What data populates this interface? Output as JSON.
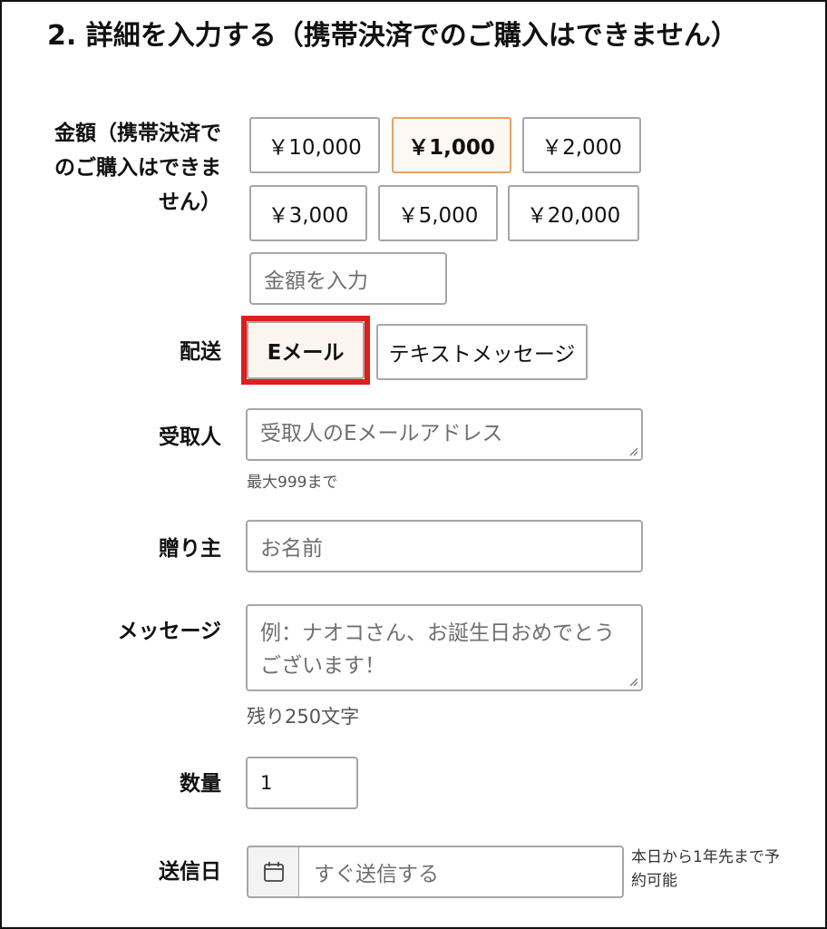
{
  "section": {
    "title": "2. 詳細を入力する（携帯決済でのご購入はできません）"
  },
  "amount": {
    "label": "金額（携帯決済でのご購入はできません）",
    "options": [
      "￥10,000",
      "￥1,000",
      "￥2,000",
      "￥3,000",
      "￥5,000",
      "￥20,000"
    ],
    "selected": "￥1,000",
    "custom_placeholder": "金額を入力"
  },
  "delivery": {
    "label": "配送",
    "options": [
      "Eメール",
      "テキストメッセージ"
    ],
    "selected": "Eメール"
  },
  "recipient": {
    "label": "受取人",
    "placeholder": "受取人のEメールアドレス",
    "hint": "最大999まで"
  },
  "sender": {
    "label": "贈り主",
    "placeholder": "お名前"
  },
  "message": {
    "label": "メッセージ",
    "placeholder": "例：ナオコさん、お誕生日おめでとうございます！",
    "hint": "残り250文字"
  },
  "quantity": {
    "label": "数量",
    "value": "1"
  },
  "send_date": {
    "label": "送信日",
    "placeholder": "すぐ送信する",
    "note": "本日から1年先まで予約可能"
  },
  "colors": {
    "selected_border": "#e5a160",
    "highlight_outline": "#e01e1e"
  },
  "icons": {
    "date_picker": "calendar-icon",
    "resize": "resize-grip-icon"
  }
}
